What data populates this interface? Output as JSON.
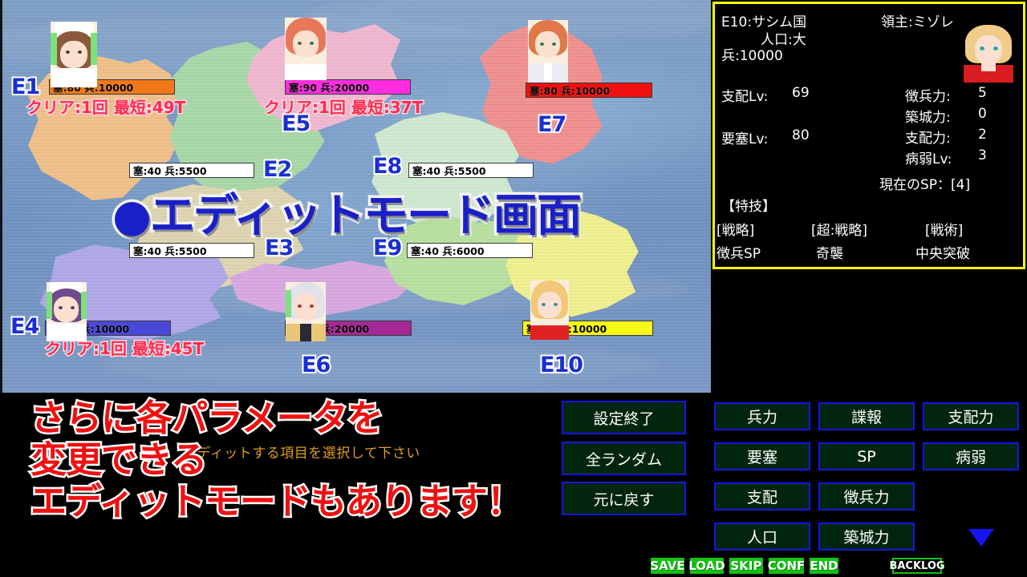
{
  "overlay": {
    "title": "●エディットモード画面",
    "promo_lines": [
      "さらに各パラメータを",
      "変更できる",
      "エディットモードもあります！"
    ],
    "promo_color": "#ef1111",
    "title_color": "#1a20c8"
  },
  "dialog": {
    "prompt": "エディットする項目を選択して下さい",
    "prompt_color": "#e09e1c",
    "next_indicator": "▼"
  },
  "info_panel": {
    "border_color": "#ffff00",
    "region_code": "E10",
    "country_label": "E10:サシム国",
    "lord_label": "領主:ミゾレ",
    "population_label": "人口:大",
    "troops_label": "兵:10000",
    "stats_left": [
      {
        "label": "支配Lv:",
        "value": "69"
      },
      {
        "label": "要塞Lv:",
        "value": "80"
      }
    ],
    "stats_right": [
      {
        "label": "徴兵力:",
        "value": "5"
      },
      {
        "label": "築城力:",
        "value": "0"
      },
      {
        "label": "支配力:",
        "value": "2"
      },
      {
        "label": "病弱Lv:",
        "value": "3"
      }
    ],
    "sp_label": "現在のSP：[4]",
    "skills_header": "【特技】",
    "skills": [
      {
        "category": "[戦略]",
        "name": "徴兵SP"
      },
      {
        "category": "[超:戦略]",
        "name": "奇襲"
      },
      {
        "category": "[戦術]",
        "name": "中央突破"
      }
    ]
  },
  "map": {
    "regions": [
      {
        "code": "E1",
        "fort": "塞:80",
        "troops": "兵:10000",
        "stat_text": "塞:80  兵:10000",
        "bar_color": "#f07818",
        "bar_fill_pct": 100,
        "clear": "クリア:1回  最短:49T",
        "has_portrait": true,
        "land_color": "#f0c08a"
      },
      {
        "code": "E2",
        "fort": "塞:40",
        "troops": "兵:5500",
        "stat_text": "塞:40  兵:5500",
        "bar_color": "#ffffff",
        "bar_fill_pct": 0,
        "clear": "",
        "has_portrait": false,
        "land_color": "#a8d8a8"
      },
      {
        "code": "E3",
        "fort": "塞:40",
        "troops": "兵:5500",
        "stat_text": "塞:40  兵:5500",
        "bar_color": "#ffffff",
        "bar_fill_pct": 0,
        "clear": "",
        "has_portrait": false,
        "land_color": "#ded4b0"
      },
      {
        "code": "E4",
        "fort": "塞:79",
        "troops": "兵:10000",
        "stat_text": "塞:79  兵:10000",
        "bar_color": "#4a48d8",
        "bar_fill_pct": 100,
        "clear": "クリア:1回  最短:45T",
        "has_portrait": true,
        "land_color": "#b0a8e8"
      },
      {
        "code": "E5",
        "fort": "塞:90",
        "troops": "兵:20000",
        "stat_text": "塞:90  兵:20000",
        "bar_color": "#ff2ce0",
        "bar_fill_pct": 100,
        "clear": "クリア:1回  最短:37T",
        "has_portrait": true,
        "land_color": "#f0b8d0"
      },
      {
        "code": "E6",
        "fort": "塞:80",
        "troops": "兵:20000",
        "stat_text": "塞:80  兵:20000",
        "bar_color": "#a52894",
        "bar_fill_pct": 100,
        "clear": "",
        "has_portrait": true,
        "land_color": "#d8a8e0"
      },
      {
        "code": "E7",
        "fort": "塞:80",
        "troops": "兵:10000",
        "stat_text": "塞:80  兵:10000",
        "bar_color": "#f01010",
        "bar_fill_pct": 100,
        "clear": "",
        "has_portrait": true,
        "land_color": "#f09090"
      },
      {
        "code": "E8",
        "fort": "塞:40",
        "troops": "兵:5500",
        "stat_text": "塞:40  兵:5500",
        "bar_color": "#ffffff",
        "bar_fill_pct": 0,
        "clear": "",
        "has_portrait": false,
        "land_color": "#cfe8cf"
      },
      {
        "code": "E9",
        "fort": "塞:40",
        "troops": "兵:6000",
        "stat_text": "塞:40  兵:6000",
        "bar_color": "#ffffff",
        "bar_fill_pct": 0,
        "clear": "",
        "has_portrait": false,
        "land_color": "#b8e0a0"
      },
      {
        "code": "E10",
        "fort": "塞:80",
        "troops": "兵:10000",
        "stat_text": "塞:80  兵:10000",
        "bar_color": "#f8f818",
        "bar_fill_pct": 100,
        "clear": "",
        "has_portrait": true,
        "land_color": "#f0f090"
      }
    ]
  },
  "left_buttons": [
    {
      "label": "設定終了"
    },
    {
      "label": "全ランダム"
    },
    {
      "label": "元に戻す"
    }
  ],
  "param_buttons": [
    {
      "label": "兵力"
    },
    {
      "label": "諜報"
    },
    {
      "label": "支配力"
    },
    {
      "label": "要塞"
    },
    {
      "label": "SP"
    },
    {
      "label": "病弱"
    },
    {
      "label": "支配"
    },
    {
      "label": "徴兵力"
    },
    {
      "label": "人口"
    },
    {
      "label": "築城力"
    }
  ],
  "system_bar": {
    "buttons": [
      "SAVE",
      "LOAD",
      "SKIP",
      "CONF",
      "END"
    ],
    "backlog": "BACKLOG",
    "button_color": "#13c313"
  }
}
